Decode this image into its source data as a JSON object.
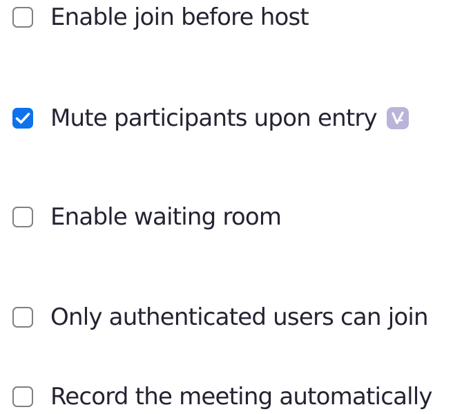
{
  "options": [
    {
      "label": "Enable join before host",
      "checked": false
    },
    {
      "label": "Mute participants upon entry",
      "checked": true,
      "badge": "verified-badge-icon"
    },
    {
      "label": "Enable waiting room",
      "checked": false
    },
    {
      "label": "Only authenticated users can join",
      "checked": false
    },
    {
      "label": "Record the meeting automatically",
      "checked": false
    }
  ],
  "colors": {
    "checkbox_checked": "#0e72ed",
    "checkbox_border": "#7f7f85",
    "label_text": "#232333",
    "badge": "#b9b4d8"
  }
}
